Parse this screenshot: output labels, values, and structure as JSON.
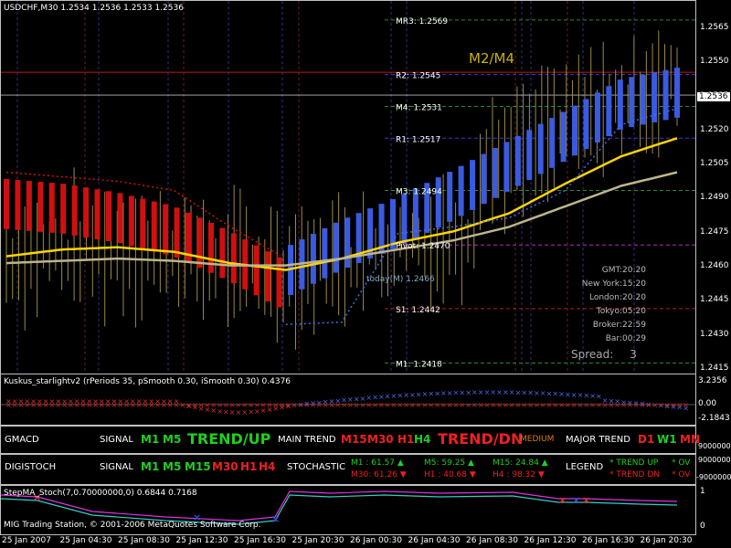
{
  "main": {
    "symbol_header": "USDCHF,M30  1.2534 1.2536 1.2533 1.2536",
    "watermark": "M2/M4",
    "today_label": "today(M) 1.2466",
    "levels": [
      {
        "label": "MR3: 1.2569",
        "price": 1.2569,
        "color": "#2e8b2e"
      },
      {
        "label": "R2: 1.2545",
        "price": 1.2545,
        "color": "#3b3bd0"
      },
      {
        "label": "M4: 1.2531",
        "price": 1.2531,
        "color": "#2e8b2e"
      },
      {
        "label": "R1: 1.2517",
        "price": 1.2517,
        "color": "#3b3bd0"
      },
      {
        "label": "M3: 1.2494",
        "price": 1.2494,
        "color": "#2e8b2e"
      },
      {
        "label": "Pivot: 1.2470",
        "price": 1.247,
        "color": "#b030b0"
      },
      {
        "label": "S1: 1.2442",
        "price": 1.2442,
        "color": "#b02020"
      },
      {
        "label": "M1: 1.2418",
        "price": 1.2418,
        "color": "#2e8b2e"
      }
    ],
    "current_price": "1.2536",
    "red_line_price": 1.2546,
    "sessions": [
      {
        "k": "GMT:",
        "v": "20:20"
      },
      {
        "k": "New York:",
        "v": "15:20"
      },
      {
        "k": "London:",
        "v": "20:20"
      },
      {
        "k": "Tokyo:",
        "v": "05:20"
      },
      {
        "k": "Broker:",
        "v": "22:59"
      },
      {
        "k": "Bar:",
        "v": "00:29"
      }
    ],
    "spread_label": "Spread:",
    "spread_value": "3"
  },
  "price_axis": [
    "1.2565",
    "1.2550",
    "1.2535",
    "1.2520",
    "1.2505",
    "1.2490",
    "1.2475",
    "1.2460",
    "1.2445",
    "1.2430",
    "1.2415"
  ],
  "kuskus": {
    "title": "Kuskus_starlightv2  (rPeriods 35, pSmooth 0.30, iSmooth 0.30)  0.4376",
    "axis": [
      "3.2356",
      "0.00",
      "-2.1843"
    ]
  },
  "gmacd": {
    "name": "GMACD",
    "signal_label": "SIGNAL",
    "signal_items": [
      "M1",
      "M5"
    ],
    "signal_trend": "TREND/UP",
    "main_trend_label": "MAIN TREND",
    "main_items": [
      "M15",
      "M30",
      "H1",
      "H4"
    ],
    "main_trend": "TREND/DN",
    "medium": "MEDIUM",
    "major_label": "MAJOR TREND",
    "major_items": [
      "D1",
      "W1",
      "MN"
    ],
    "axis": "9000000"
  },
  "digistoch": {
    "name": "DIGISTOCH",
    "signal_label": "SIGNAL",
    "signal_green": [
      "M1",
      "M5",
      "M15"
    ],
    "signal_red": [
      "M30",
      "H1",
      "H4"
    ],
    "stochastic_label": "STOCHASTIC",
    "stoch_rows": [
      [
        "M1 : 61.57 ▲",
        "M5: 59.25 ▲",
        "M15: 24.84 ▲"
      ],
      [
        "M30: 61.26 ▼",
        "H1 : 40.68 ▼",
        "H4  : 98.32 ▼"
      ]
    ],
    "legend_label": "LEGEND",
    "legend_up": "* TREND UP",
    "legend_dn": "* TREND DN",
    "legend_up2": "* OV",
    "legend_dn2": "* OV",
    "axis": [
      "9000000",
      "-9000000"
    ]
  },
  "stepma": {
    "title": "StepMA_Stoch(7,0.70000000,0)  0.6844  0.7168",
    "axis": [
      "1",
      "0"
    ]
  },
  "copyright": "MIG Trading Station, © 2001-2006 MetaQuotes Software Corp.",
  "time_axis": [
    "25 Jan 2007",
    "25 Jan 04:30",
    "25 Jan 08:30",
    "25 Jan 12:30",
    "25 Jan 16:30",
    "25 Jan 20:30",
    "26 Jan 00:30",
    "26 Jan 04:30",
    "26 Jan 08:30",
    "26 Jan 12:30",
    "26 Jan 16:30",
    "26 Jan 20:30"
  ],
  "chart_data": {
    "type": "line",
    "price_range": [
      1.2415,
      1.2575
    ],
    "x_labels": [
      "25 Jan 2007",
      "25 Jan 04:30",
      "25 Jan 08:30",
      "25 Jan 12:30",
      "25 Jan 16:30",
      "25 Jan 20:30",
      "26 Jan 00:30",
      "26 Jan 04:30",
      "26 Jan 08:30",
      "26 Jan 12:30",
      "26 Jan 16:30",
      "26 Jan 20:30"
    ],
    "series": [
      {
        "color": "#ffd400",
        "values": [
          1.2465,
          1.2468,
          1.2469,
          1.2467,
          1.2462,
          1.2459,
          1.2464,
          1.2471,
          1.2476,
          1.2484,
          1.2497,
          1.2509,
          1.2517
        ]
      },
      {
        "color": "#bdb58a",
        "values": [
          1.2462,
          1.2463,
          1.2464,
          1.2463,
          1.2461,
          1.2461,
          1.2464,
          1.2468,
          1.2472,
          1.2478,
          1.2487,
          1.2496,
          1.2502
        ]
      },
      {
        "color": "#d01010",
        "values": [
          1.2502,
          1.25,
          1.2498,
          1.2494,
          1.2478,
          1.2464,
          null,
          null,
          null,
          null,
          null,
          null,
          null
        ]
      },
      {
        "color": "#4070e0",
        "values": [
          null,
          null,
          null,
          null,
          null,
          1.2435,
          1.2436,
          1.2475,
          1.2478,
          1.2482,
          1.2494,
          1.2523,
          1.253
        ]
      }
    ],
    "hull_bands": [
      {
        "color": "#d01010",
        "values": [
          1.2488,
          1.2486,
          1.2482,
          1.2476,
          1.2465,
          1.2452,
          null,
          null,
          null,
          null,
          null,
          null,
          null
        ]
      },
      {
        "color": "#3a5be0",
        "values": [
          null,
          null,
          null,
          null,
          null,
          1.2458,
          1.247,
          1.248,
          1.2492,
          1.2505,
          1.2518,
          1.2532,
          1.2537
        ]
      }
    ]
  }
}
